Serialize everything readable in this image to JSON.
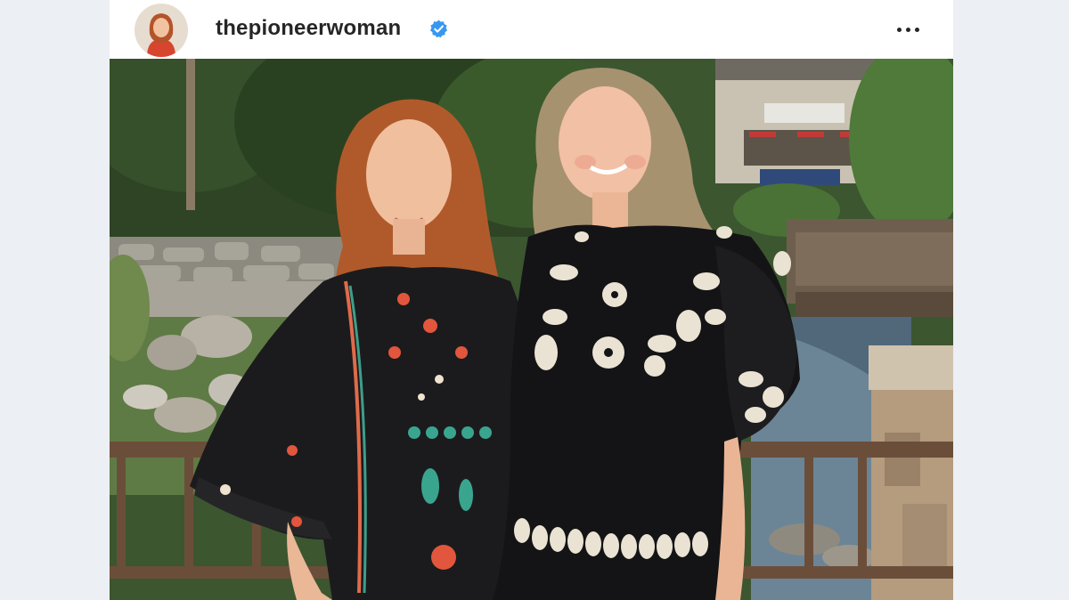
{
  "post": {
    "username": "thepioneerwoman",
    "verified": true,
    "avatar_icon": "profile-avatar",
    "more_icon": "ellipsis-horizontal-icon",
    "verified_icon": "verified-badge-icon"
  },
  "colors": {
    "verified_blue": "#3897f0",
    "text": "#262626",
    "side_background": "#eceff3"
  }
}
